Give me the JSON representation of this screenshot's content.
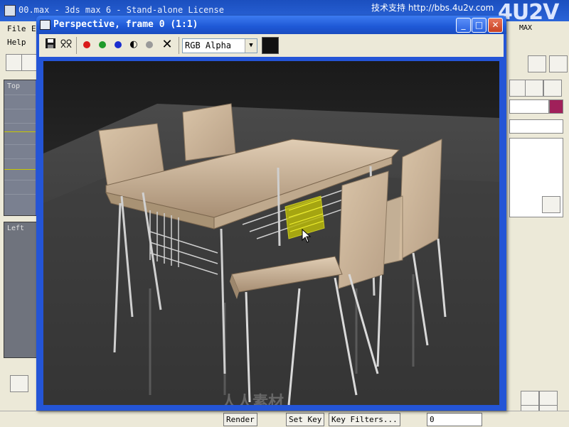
{
  "main_window": {
    "title": "00.max - 3ds max 6 - Stand-alone License",
    "support_text": "技术支持 http://bbs.4u2v.com",
    "logo_text": "4U2V"
  },
  "menu": {
    "file": "File",
    "edit_initial": "E",
    "help": "Help"
  },
  "viewports": {
    "top_label": "Top",
    "left_label": "Left"
  },
  "render_window": {
    "title": "Perspective, frame 0 (1:1)",
    "channel": "RGB Alpha",
    "swatch_color": "#111111"
  },
  "toolbar_icons": [
    "save-icon",
    "clone-icon",
    "red-channel-icon",
    "green-channel-icon",
    "blue-channel-icon",
    "monochrome-icon",
    "clear-icon",
    "close-icon"
  ],
  "statusbar": {
    "render_label": "Render",
    "set_key": "Set Key",
    "key_filters": "Key Filters...",
    "frame_value": "0"
  },
  "watermark_text": "人人素材",
  "right_panel": {
    "partial_label": "MAX"
  },
  "colors": {
    "title_bar": "#2455d6",
    "accent_swatch": "#a0205a"
  }
}
